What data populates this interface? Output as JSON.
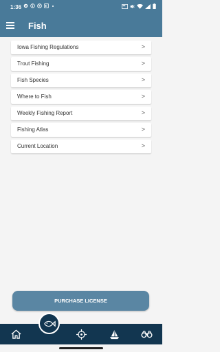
{
  "status": {
    "time": "1:36"
  },
  "appbar": {
    "title": "Fish",
    "menu_icon": "hamburger-menu-icon"
  },
  "menu_items": [
    {
      "label": "Iowa Fishing Regulations"
    },
    {
      "label": "Trout Fishing"
    },
    {
      "label": "Fish Species"
    },
    {
      "label": "Where to Fish"
    },
    {
      "label": "Weekly Fishing Report"
    },
    {
      "label": "Fishing Atlas"
    },
    {
      "label": "Current Location"
    }
  ],
  "chevron": ">",
  "purchase_button": {
    "label": "PURCHASE LICENSE"
  },
  "bottom_nav": {
    "icons": [
      "home-icon",
      "fish-icon",
      "crosshair-icon",
      "sailboat-icon",
      "binoculars-icon"
    ]
  },
  "colors": {
    "header": "#497a99",
    "nav_bar": "#123650",
    "button": "#5a86a3",
    "background": "#f4f4f4"
  }
}
